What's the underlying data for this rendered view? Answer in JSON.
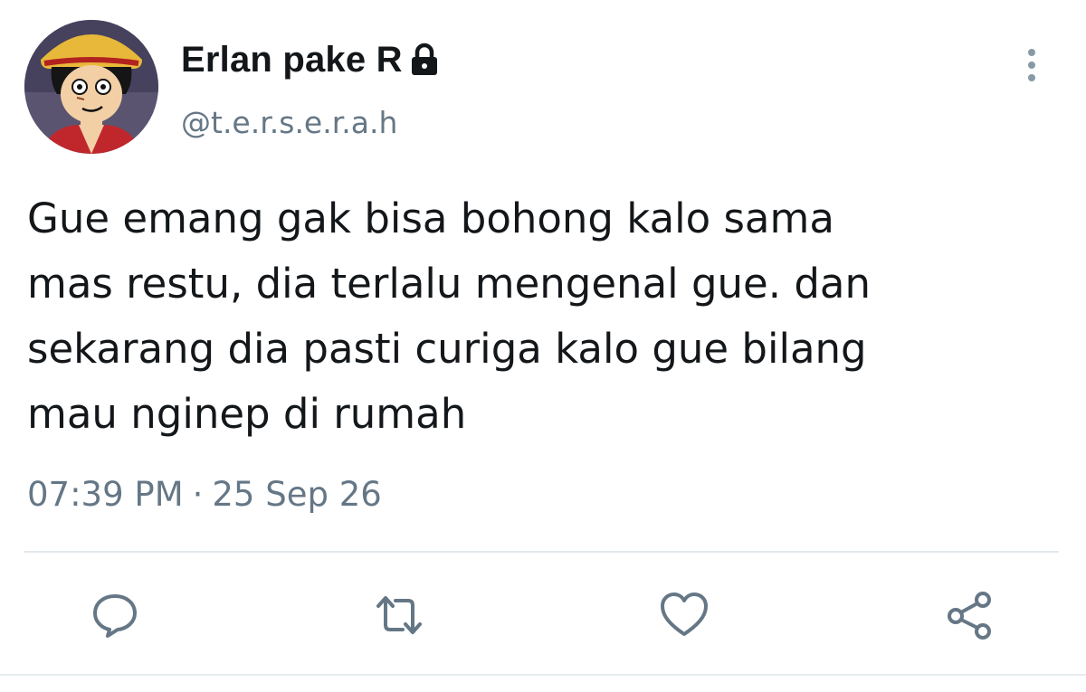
{
  "user": {
    "display_name": "Erlan pake R",
    "handle": "@t.e.r.s.e.r.a.h",
    "protected_icon": "lock-icon",
    "avatar": "avatar"
  },
  "tweet": {
    "text": "Gue emang gak bisa bohong kalo sama\nmas restu, dia terlalu mengenal gue. dan\nsekarang dia pasti curiga kalo gue bilang\nmau nginep di rumah",
    "time": "07:39 PM",
    "separator": "·",
    "date": "25 Sep 26"
  },
  "actions": {
    "reply_icon": "reply-icon",
    "retweet_icon": "retweet-icon",
    "like_icon": "heart-icon",
    "share_icon": "share-icon",
    "more_icon": "more-vertical-icon"
  },
  "colors": {
    "text_primary": "#14171a",
    "text_secondary": "#657786",
    "icon": "#657786",
    "divider": "#e1e8ed"
  }
}
